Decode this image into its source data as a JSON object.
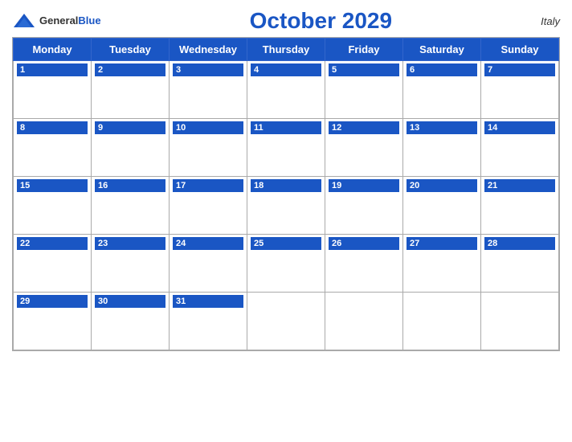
{
  "header": {
    "logo_general": "General",
    "logo_blue": "Blue",
    "title": "October 2029",
    "country": "Italy"
  },
  "days_of_week": [
    "Monday",
    "Tuesday",
    "Wednesday",
    "Thursday",
    "Friday",
    "Saturday",
    "Sunday"
  ],
  "weeks": [
    [
      1,
      2,
      3,
      4,
      5,
      6,
      7
    ],
    [
      8,
      9,
      10,
      11,
      12,
      13,
      14
    ],
    [
      15,
      16,
      17,
      18,
      19,
      20,
      21
    ],
    [
      22,
      23,
      24,
      25,
      26,
      27,
      28
    ],
    [
      29,
      30,
      31,
      null,
      null,
      null,
      null
    ]
  ],
  "accent_color": "#1a56c4"
}
